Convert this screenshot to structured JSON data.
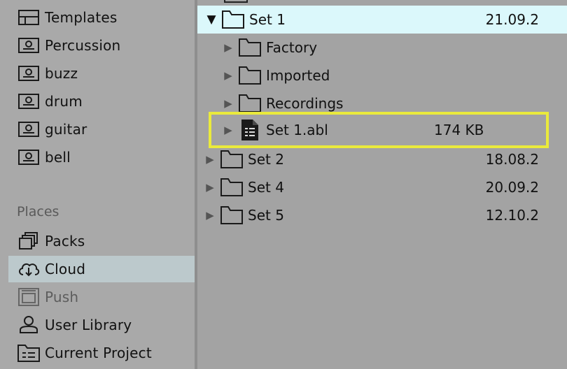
{
  "sidebar": {
    "items": [
      {
        "label": "Templates",
        "icon": "templates-icon"
      },
      {
        "label": "Percussion",
        "icon": "user-folder-icon"
      },
      {
        "label": "buzz",
        "icon": "user-folder-icon"
      },
      {
        "label": "drum",
        "icon": "user-folder-icon"
      },
      {
        "label": "guitar",
        "icon": "user-folder-icon"
      },
      {
        "label": "bell",
        "icon": "user-folder-icon"
      }
    ],
    "places_heading": "Places",
    "places": [
      {
        "label": "Packs",
        "icon": "packs-icon"
      },
      {
        "label": "Cloud",
        "icon": "cloud-icon",
        "selected": true
      },
      {
        "label": "Push",
        "icon": "push-icon",
        "disabled": true
      },
      {
        "label": "User Library",
        "icon": "user-icon"
      },
      {
        "label": "Current Project",
        "icon": "project-icon"
      }
    ]
  },
  "browser": {
    "rows": [
      {
        "name": "Set 1",
        "date": "21.09.2",
        "type": "folder",
        "expanded": true,
        "selected": true,
        "level": 0
      },
      {
        "name": "Factory",
        "type": "folder",
        "level": 1
      },
      {
        "name": "Imported",
        "type": "folder",
        "level": 1
      },
      {
        "name": "Recordings",
        "type": "folder",
        "level": 1
      },
      {
        "name": "Set 1.abl",
        "size": "174 KB",
        "type": "file",
        "level": 1,
        "highlighted": true
      },
      {
        "name": "Set 2",
        "date": "18.08.2",
        "type": "folder",
        "level": 0
      },
      {
        "name": "Set 4",
        "date": "20.09.2",
        "type": "folder",
        "level": 0
      },
      {
        "name": "Set 5",
        "date": "12.10.2",
        "type": "folder",
        "level": 0
      }
    ]
  },
  "colors": {
    "sidebar_bg": "#a9a9a9",
    "main_bg": "#a3a3a3",
    "selected_row": "#dbf8fb",
    "selected_place": "#bcc9cc",
    "highlight_border": "#eaea3c"
  }
}
